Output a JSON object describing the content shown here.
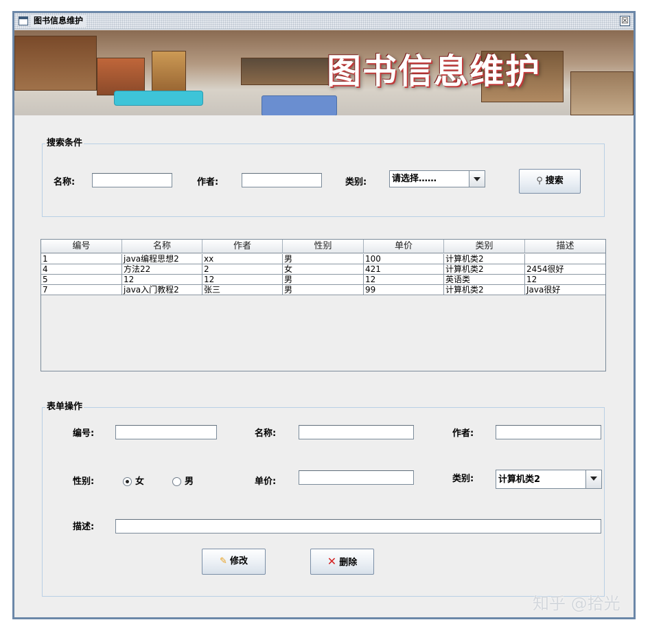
{
  "window": {
    "title": "图书信息维护",
    "close": "☒"
  },
  "banner": {
    "title": "图书信息维护"
  },
  "search": {
    "legend": "搜索条件",
    "name_label": "名称:",
    "name_value": "",
    "author_label": "作者:",
    "author_value": "",
    "category_label": "类别:",
    "category_selected": "请选择……",
    "search_button": "搜索"
  },
  "table": {
    "columns": [
      "编号",
      "名称",
      "作者",
      "性别",
      "单价",
      "类别",
      "描述"
    ],
    "rows": [
      [
        "1",
        "java编程思想2",
        "xx",
        "男",
        "100",
        "计算机类2",
        ""
      ],
      [
        "4",
        "方法22",
        "2",
        "女",
        "421",
        "计算机类2",
        "2454很好"
      ],
      [
        "5",
        "12",
        "12",
        "男",
        "12",
        "英语类",
        "12"
      ],
      [
        "7",
        "java入门教程2",
        "张三",
        "男",
        "99",
        "计算机类2",
        "Java很好"
      ]
    ]
  },
  "form": {
    "legend": "表单操作",
    "id_label": "编号:",
    "id_value": "",
    "name_label": "名称:",
    "name_value": "",
    "author_label": "作者:",
    "author_value": "",
    "gender_label": "性别:",
    "gender_female": "女",
    "gender_male": "男",
    "gender_selected": "女",
    "price_label": "单价:",
    "price_value": "",
    "category_label": "类别:",
    "category_selected": "计算机类2",
    "desc_label": "描述:",
    "desc_value": "",
    "edit_button": "修改",
    "delete_button": "删除"
  },
  "watermark": "知乎 @拾光",
  "colors": {
    "border": "#6b87a8",
    "panel": "#eeeeee",
    "group_border": "#b8cfe5",
    "delete_icon": "#d42020",
    "edit_icon": "#e8a020"
  }
}
